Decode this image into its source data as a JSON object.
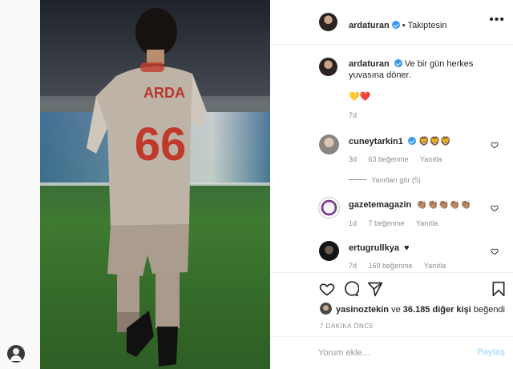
{
  "post": {
    "author": "ardaturan",
    "follow_status": "Takiptesin",
    "dot": "•",
    "more": "•••",
    "caption_user": "ardaturan",
    "caption_line1": "Ve bir gün herkes",
    "caption_line2": "yuvasına döner.",
    "caption_emojis": "💛❤️",
    "caption_time": "7d",
    "jersey_name": "ARDA",
    "jersey_number": "66"
  },
  "comments": [
    {
      "user": "cuneytarkin1",
      "text": "🦁🦁🦁",
      "time": "3d",
      "likes": "63 beğenme",
      "reply": "Yanıtla",
      "view_replies": "Yanıtları gör (5)"
    },
    {
      "user": "gazetemagazin",
      "text": "👏🏽👏🏽👏🏽👏🏽👏🏽",
      "time": "1d",
      "likes": "7 beğenme",
      "reply": "Yanıtla"
    },
    {
      "user": "ertugrullkya",
      "text": "♥",
      "time": "7d",
      "likes": "169 beğenme",
      "reply": "Yanıtla"
    }
  ],
  "likes": {
    "user": "yasinoztekin",
    "connector": "ve",
    "count": "36.185 diğer kişi",
    "suffix": "beğendi"
  },
  "timestamp": "7 DAKİKA ÖNCE",
  "composer": {
    "placeholder": "Yorum ekle...",
    "share_label": "Paylaş"
  },
  "icons": [
    "heart-icon",
    "comment-icon",
    "share-icon",
    "bookmark-icon",
    "more-options-icon",
    "verified-badge-icon"
  ],
  "colors": {
    "verified": "#3897f0",
    "muted": "#8e8e8e",
    "share_disabled": "#b2dffc"
  }
}
